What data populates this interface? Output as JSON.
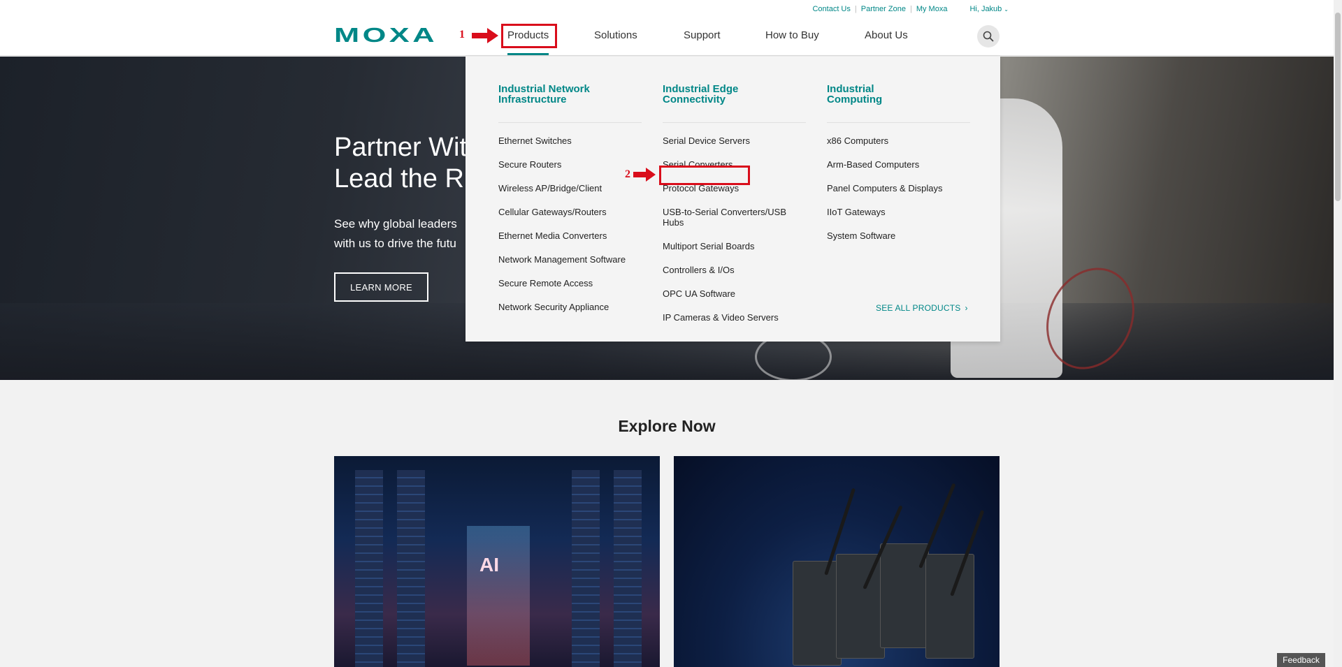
{
  "utility": {
    "contact": "Contact Us",
    "partner": "Partner Zone",
    "mymoxa": "My Moxa",
    "user": "Hi, Jakub"
  },
  "logo": {
    "text": "MOXA",
    "color": "#008787"
  },
  "nav": {
    "products": "Products",
    "solutions": "Solutions",
    "support": "Support",
    "how_to_buy": "How to Buy",
    "about": "About Us"
  },
  "annotations": {
    "step1": "1",
    "step2": "2",
    "color": "#d90d1b"
  },
  "hero": {
    "title_line1": "Partner With",
    "title_line2": "Lead the R",
    "sub_line1": "See why global leaders",
    "sub_line2": "with us to drive the futu",
    "cta": "LEARN MORE"
  },
  "menu": {
    "col1": {
      "head_line1": "Industrial Network",
      "head_line2": "Infrastructure",
      "items": [
        "Ethernet Switches",
        "Secure Routers",
        "Wireless AP/Bridge/Client",
        "Cellular Gateways/Routers",
        "Ethernet Media Converters",
        "Network Management Software",
        "Secure Remote Access",
        "Network Security Appliance"
      ]
    },
    "col2": {
      "head_line1": "Industrial Edge",
      "head_line2": "Connectivity",
      "items": [
        "Serial Device Servers",
        "Serial Converters",
        "Protocol Gateways",
        "USB-to-Serial Converters/USB Hubs",
        "Multiport Serial Boards",
        "Controllers & I/Os",
        "OPC UA Software",
        "IP Cameras & Video Servers"
      ]
    },
    "col3": {
      "head_line1": "Industrial",
      "head_line2": "Computing",
      "items": [
        "x86 Computers",
        "Arm-Based Computers",
        "Panel Computers & Displays",
        "IIoT Gateways",
        "System Software"
      ]
    },
    "see_all": "SEE ALL PRODUCTS",
    "accent": "#008787"
  },
  "explore": {
    "title": "Explore Now",
    "card1_overlay": "AI"
  },
  "feedback": "Feedback"
}
